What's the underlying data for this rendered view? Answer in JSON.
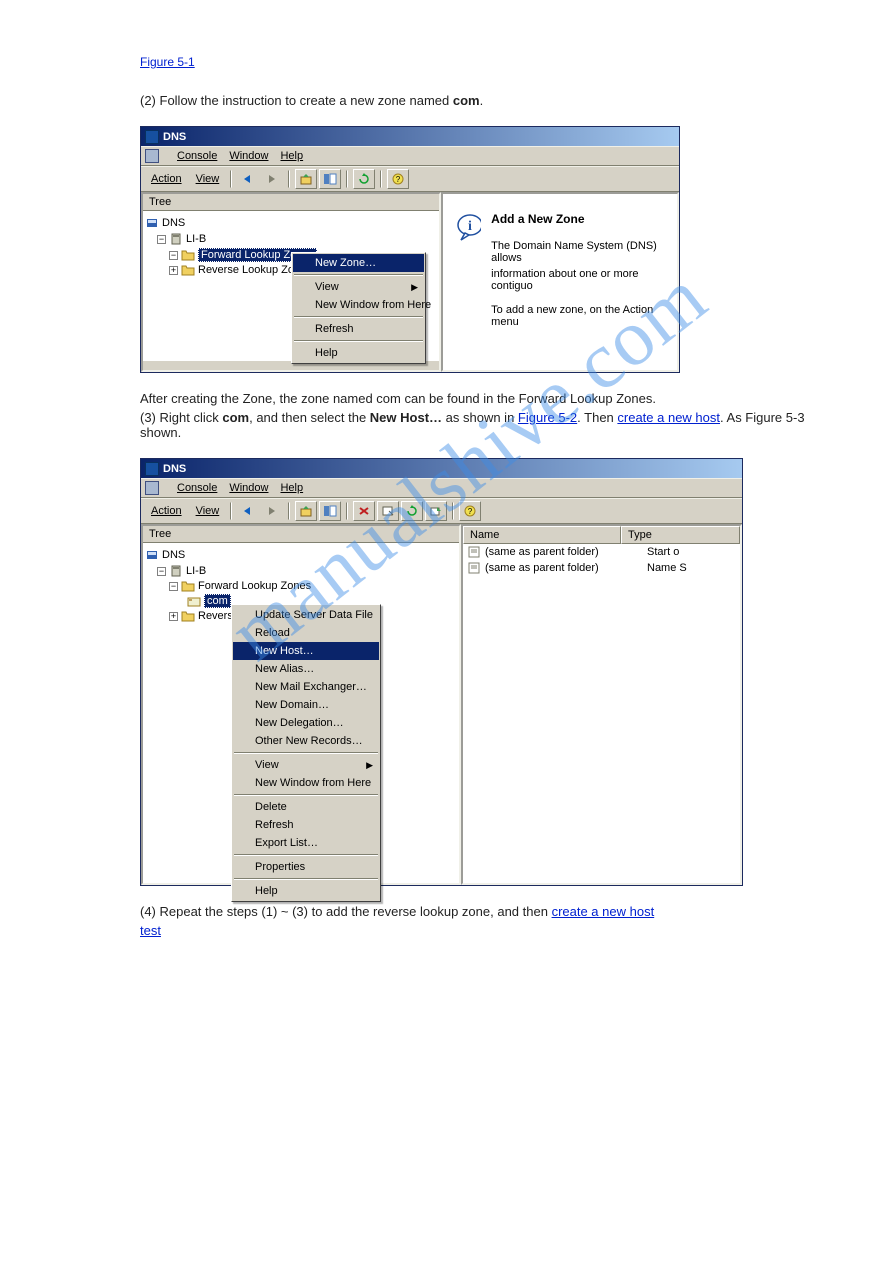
{
  "doclinks": {
    "fig51": "Figure 5-1",
    "fig52": "Figure 5-2",
    "create1": "create a new host",
    "create2": "test"
  },
  "doc": {
    "p1_a": "(2) Follow the instruction to create a new zone named ",
    "p1_b": "com",
    "p1_c": ".",
    "p2_a": "(3) Right click ",
    "p2_b": "com",
    "p2_c": ", and then select the ",
    "p2_d": "New Host…",
    "p2_e": " as shown in ",
    "p2_f": ". Then ",
    "p3_a": ". As Figure 5-3 shown.",
    "after1": "After creating the Zone, the zone named com can be found in the Forward Lookup Zones.",
    "p4a": "(4) Repeat the steps (1) ~ (3) to add the reverse lookup zone, and then "
  },
  "watermark": "manualshive.com",
  "win1": {
    "title": "DNS",
    "menus": {
      "console": "Console",
      "window": "Window",
      "help": "Help"
    },
    "toolmenus": {
      "action": "Action",
      "view": "View"
    },
    "treehead": "Tree",
    "nodes": {
      "root": "DNS",
      "server": "LI-B",
      "flz": "Forward Lookup Zones",
      "rlz": "Reverse Lookup Zone"
    },
    "ctx": {
      "newzone": "New Zone…",
      "view": "View",
      "newwin": "New Window from Here",
      "refresh": "Refresh",
      "help": "Help"
    },
    "right": {
      "head": "Add a New Zone",
      "p1": "The Domain Name System (DNS) allows",
      "p2": "information about one or more contiguo",
      "p3": "To add a new zone, on the Action menu"
    }
  },
  "win2": {
    "title": "DNS",
    "menus": {
      "console": "Console",
      "window": "Window",
      "help": "Help"
    },
    "toolmenus": {
      "action": "Action",
      "view": "View"
    },
    "treehead": "Tree",
    "nodes": {
      "root": "DNS",
      "server": "LI-B",
      "flz": "Forward Lookup Zones",
      "com": "com",
      "rlz": "Revers"
    },
    "ctx": {
      "r1": "Update Server Data File",
      "r2": "Reload",
      "r3": "New Host…",
      "r4": "New Alias…",
      "r5": "New Mail Exchanger…",
      "r6": "New Domain…",
      "r7": "New Delegation…",
      "r8": "Other New Records…",
      "r9": "View",
      "r10": "New Window from Here",
      "r11": "Delete",
      "r12": "Refresh",
      "r13": "Export List…",
      "r14": "Properties",
      "r15": "Help"
    },
    "list": {
      "colname": "Name",
      "coltype": "Type",
      "row1name": "(same as parent folder)",
      "row1type": "Start o",
      "row2name": "(same as parent folder)",
      "row2type": "Name S"
    }
  }
}
